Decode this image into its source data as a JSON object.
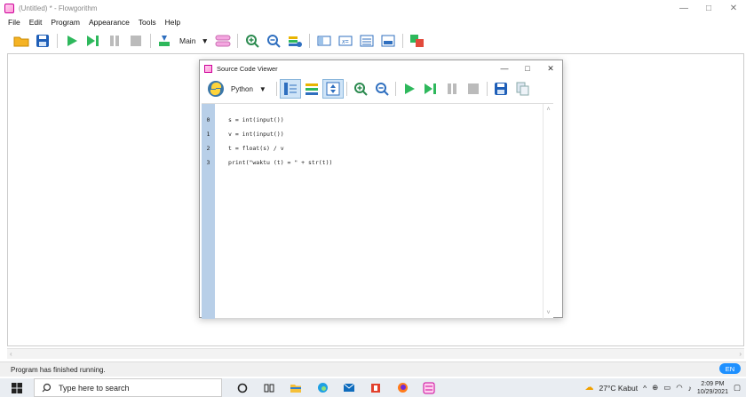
{
  "window": {
    "title": "(Untitled) * - Flowgorithm",
    "minimize": "—",
    "maximize": "□",
    "close": "✕"
  },
  "menu": [
    "File",
    "Edit",
    "Program",
    "Appearance",
    "Tools",
    "Help"
  ],
  "toolbar": {
    "function_select": "Main"
  },
  "dialog": {
    "title": "Source Code Viewer",
    "language": "Python",
    "minimize": "—",
    "maximize": "□",
    "close": "✕"
  },
  "code": {
    "lines": [
      {
        "num": "0",
        "text": "s = int(input())"
      },
      {
        "num": "1",
        "text": "v = int(input())"
      },
      {
        "num": "2",
        "text": "t = float(s) / v"
      },
      {
        "num": "3",
        "text": "print(\"waktu (t) = \" + str(t))"
      }
    ]
  },
  "status": {
    "message": "Program has finished running.",
    "lang_badge": "EN"
  },
  "taskbar": {
    "search_placeholder": "Type here to search",
    "weather": "27°C  Kabut",
    "time": "2:09 PM",
    "date": "10/29/2021"
  },
  "colors": {
    "play_green": "#2eb85c",
    "gutter_blue": "#b8cfe8",
    "accent_blue": "#1e90ff"
  }
}
